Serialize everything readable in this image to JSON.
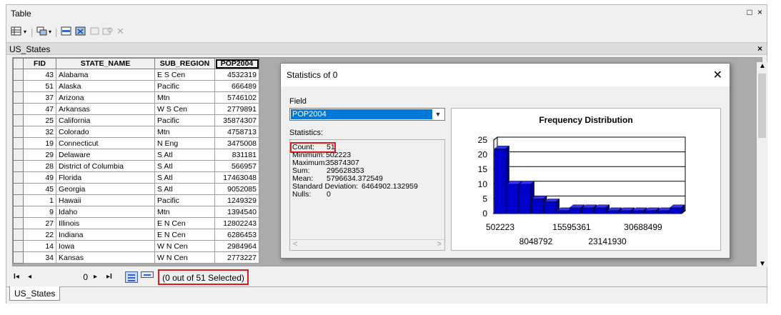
{
  "window": {
    "title": "Table",
    "controls": "□ ×"
  },
  "toolbar": {
    "icons": [
      "table-options-icon",
      "dropdown-icon",
      "related-tables-icon",
      "dropdown-icon",
      "select-by-attributes-icon",
      "switch-selection-icon",
      "clear-selection-icon",
      "zoom-to-selected-icon",
      "delete-selected-icon"
    ]
  },
  "tab": {
    "label": "US_States",
    "close": "×"
  },
  "grid": {
    "columns": [
      "FID",
      "STATE_NAME",
      "SUB_REGION",
      "POP2004"
    ],
    "rows": [
      {
        "fid": "43",
        "name": "Alabama",
        "sub": "E S Cen",
        "pop": "4532319"
      },
      {
        "fid": "51",
        "name": "Alaska",
        "sub": "Pacific",
        "pop": "666489"
      },
      {
        "fid": "37",
        "name": "Arizona",
        "sub": "Mtn",
        "pop": "5746102"
      },
      {
        "fid": "47",
        "name": "Arkansas",
        "sub": "W S Cen",
        "pop": "2779891"
      },
      {
        "fid": "25",
        "name": "California",
        "sub": "Pacific",
        "pop": "35874307"
      },
      {
        "fid": "32",
        "name": "Colorado",
        "sub": "Mtn",
        "pop": "4758713"
      },
      {
        "fid": "19",
        "name": "Connecticut",
        "sub": "N Eng",
        "pop": "3475008"
      },
      {
        "fid": "29",
        "name": "Delaware",
        "sub": "S Atl",
        "pop": "831181"
      },
      {
        "fid": "28",
        "name": "District of Columbia",
        "sub": "S Atl",
        "pop": "566957"
      },
      {
        "fid": "49",
        "name": "Florida",
        "sub": "S Atl",
        "pop": "17463048"
      },
      {
        "fid": "45",
        "name": "Georgia",
        "sub": "S Atl",
        "pop": "9052085"
      },
      {
        "fid": "1",
        "name": "Hawaii",
        "sub": "Pacific",
        "pop": "1249329"
      },
      {
        "fid": "9",
        "name": "Idaho",
        "sub": "Mtn",
        "pop": "1394540"
      },
      {
        "fid": "27",
        "name": "Illinois",
        "sub": "E N Cen",
        "pop": "12802243"
      },
      {
        "fid": "22",
        "name": "Indiana",
        "sub": "E N Cen",
        "pop": "6286453"
      },
      {
        "fid": "14",
        "name": "Iowa",
        "sub": "W N Cen",
        "pop": "2984964"
      },
      {
        "fid": "34",
        "name": "Kansas",
        "sub": "W N Cen",
        "pop": "2773227"
      }
    ]
  },
  "navigation": {
    "first": "I◂",
    "prev": "◂",
    "record": "0",
    "next": "▸",
    "last": "▸I",
    "selection_text": "(0 out of 51 Selected)"
  },
  "bottom_tab": {
    "label": "US_States"
  },
  "dialog": {
    "title": "Statistics of 0",
    "close": "✕",
    "field_label": "Field",
    "field_value": "POP2004",
    "statistics_label": "Statistics:",
    "stats": [
      {
        "label": "Count:",
        "value": "51"
      },
      {
        "label": "Minimum:",
        "value": "502223"
      },
      {
        "label": "Maximum:",
        "value": "35874307"
      },
      {
        "label": "Sum:",
        "value": "295628353"
      },
      {
        "label": "Mean:",
        "value": "5796634.372549"
      },
      {
        "label": "Standard Deviation:",
        "value": "6464902.132959"
      },
      {
        "label": "Nulls:",
        "value": "0"
      }
    ],
    "hscroll_left": "<",
    "hscroll_right": ">"
  },
  "chart_data": {
    "type": "bar",
    "title": "Frequency Distribution",
    "ylim": [
      0,
      25
    ],
    "yticks": [
      "0",
      "5",
      "10",
      "15",
      "20",
      "25"
    ],
    "xtick_labels_row1": [
      "502223",
      "15595361",
      "30688499"
    ],
    "xtick_labels_row2": [
      "8048792",
      "23141930"
    ],
    "values": [
      22,
      10,
      10,
      5,
      4,
      1,
      2,
      2,
      2,
      1,
      1,
      1,
      1,
      1,
      2
    ],
    "bar_color": "#0000cd",
    "grid": true,
    "xlabel": "",
    "ylabel": ""
  },
  "colors": {
    "highlight": "#e31a1c",
    "selection": "#0078d7"
  }
}
